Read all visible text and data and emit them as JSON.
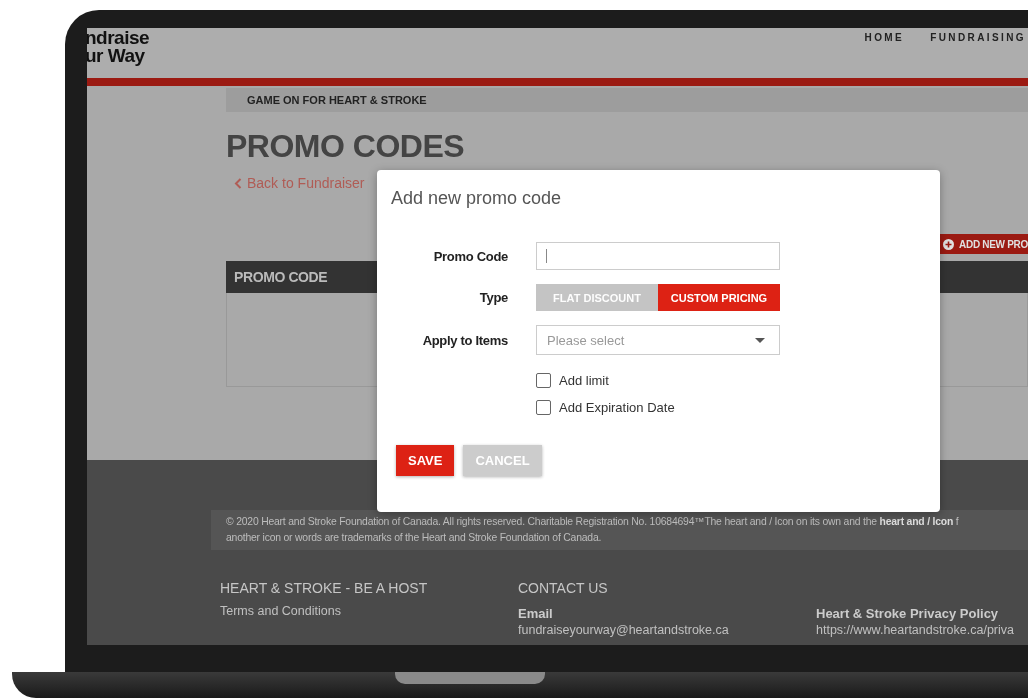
{
  "header": {
    "logo_lines": [
      "ndraise",
      "ur Way"
    ],
    "nav": [
      {
        "label": "HOME"
      },
      {
        "label": "FUNDRAISING"
      }
    ]
  },
  "breadcrumb": "GAME ON FOR HEART & STROKE",
  "page_title": "PROMO CODES",
  "back_link": "Back to Fundraiser",
  "add_button": "ADD NEW PRO",
  "table": {
    "columns": [
      "PROMO CODE"
    ]
  },
  "modal": {
    "title": "Add new promo code",
    "fields": [
      {
        "kind": "text",
        "label": "Promo Code"
      },
      {
        "kind": "toggle",
        "label": "Type",
        "options": [
          {
            "label": "FLAT DISCOUNT",
            "selected": false
          },
          {
            "label": "CUSTOM PRICING",
            "selected": true
          }
        ]
      },
      {
        "kind": "select",
        "label": "Apply to Items",
        "placeholder": "Please select"
      }
    ],
    "checkboxes": [
      {
        "label": "Add limit",
        "checked": false
      },
      {
        "label": "Add Expiration Date",
        "checked": false
      }
    ],
    "buttons": [
      {
        "label": "SAVE",
        "kind": "primary"
      },
      {
        "label": "CANCEL",
        "kind": "secondary"
      }
    ]
  },
  "footer": {
    "copyright": [
      "© 2020 Heart and Stroke Foundation of Canada. All rights reserved. Charitable Registration No. 10684694™The heart and / Icon on its own and the **heart and / Icon** f",
      "another icon or words are trademarks of the Heart and Stroke Foundation of Canada."
    ],
    "columns": [
      {
        "heading": "HEART & STROKE - BE A HOST",
        "entries": [
          {
            "text": "Terms and Conditions"
          }
        ]
      },
      {
        "heading": "CONTACT US",
        "entries": [
          {
            "title": "Email",
            "text": "fundraiseyourway@heartandstroke.ca"
          }
        ]
      },
      {
        "entries": [
          {
            "title": "Heart & Stroke Privacy Policy",
            "text": "https://www.heartandstroke.ca/priva"
          }
        ]
      }
    ]
  }
}
